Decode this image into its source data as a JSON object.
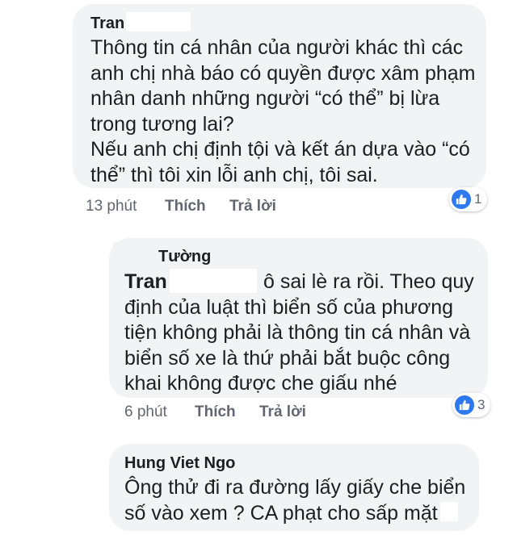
{
  "comments": [
    {
      "author": "Tran",
      "body": "Thông tin cá nhân của người khác thì các\nanh chị nhà báo có quyền được xâm phạm\nnhân danh những người “có thể” bị lừa\ntrong tương lai?\nNếu anh chị định tội và kết án dựa vào “có\nthể” thì tôi xin lỗi anh chị, tôi sai.",
      "time": "13 phút",
      "like_label": "Thích",
      "reply_label": "Trả lời",
      "reaction_count": "1",
      "reaction_icon": "thumbs-up-icon"
    },
    {
      "author": "Tường",
      "mention": "Tran",
      "body_first": "ô sai lè ra rồi. Theo quy",
      "body": "định của luật thì biển số của phương\ntiện không phải là thông tin cá nhân và\nbiển số xe là thứ phải bắt buộc công\nkhai không được che giấu nhé",
      "time": "6 phút",
      "like_label": "Thích",
      "reply_label": "Trả lời",
      "reaction_count": "3",
      "reaction_icon": "thumbs-up-icon"
    },
    {
      "author": "Hung Viet Ngo",
      "body": "Ông thử đi ra đường lấy giấy che biển\nsố vào xem ? CA phạt cho sấp mặt"
    }
  ],
  "colors": {
    "bubble": "#f2f3f5",
    "text": "#1c1e21",
    "meta": "#606770",
    "like_blue": "#2e78f0"
  }
}
